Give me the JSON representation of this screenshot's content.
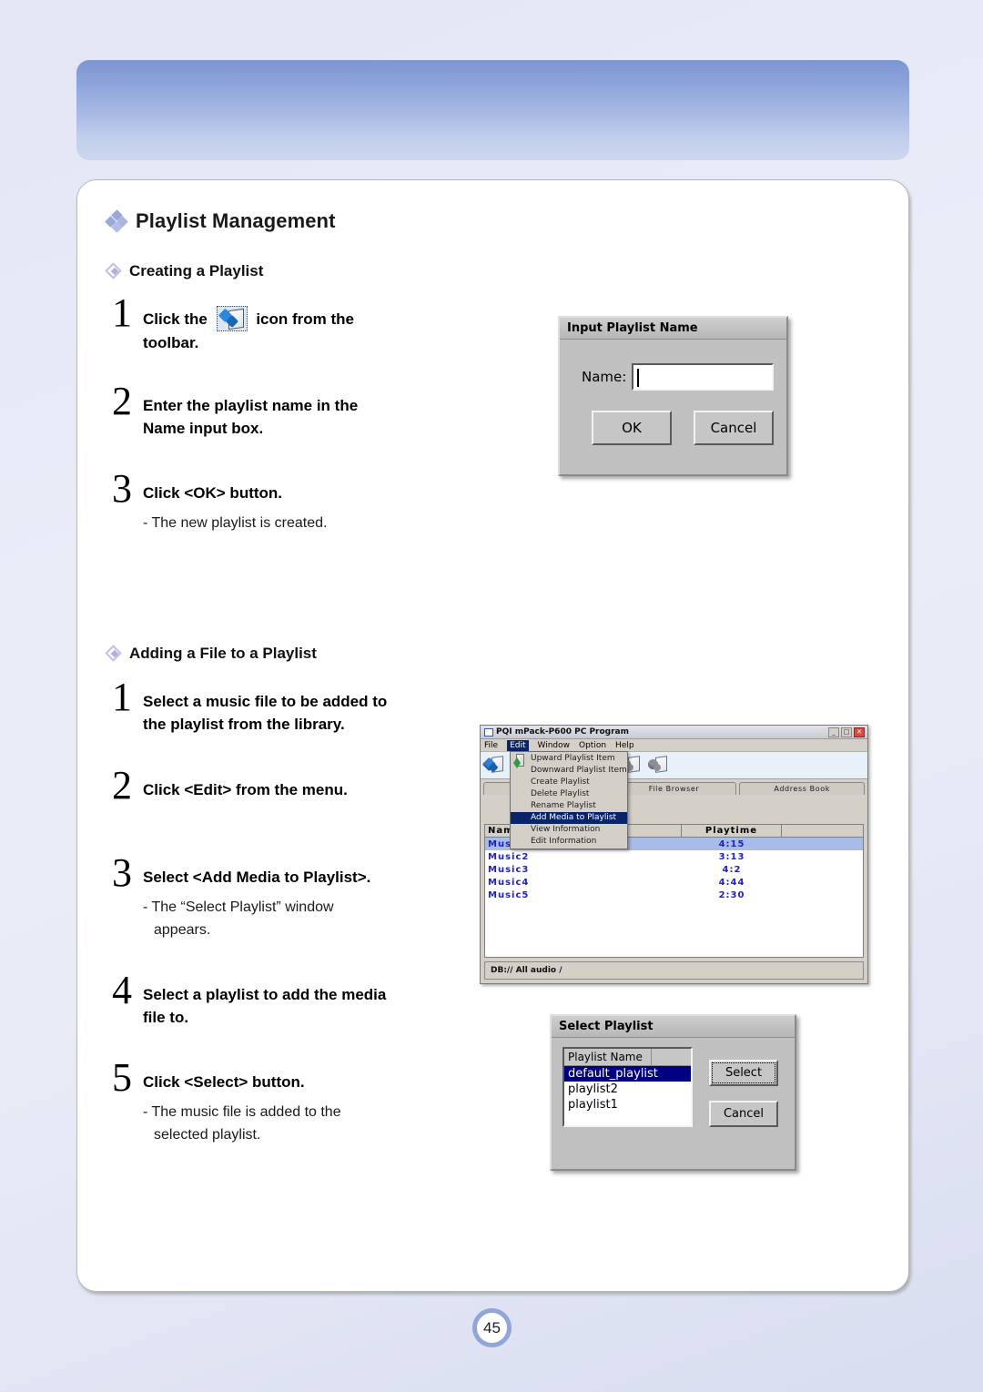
{
  "page": {
    "number": "45",
    "accent_blue": "#8fa6d8",
    "banner_color": "#8ca2d9"
  },
  "section": {
    "title": "Playlist Management"
  },
  "creating": {
    "heading": "Creating a Playlist",
    "steps": [
      {
        "num": "1",
        "pre": "Click the",
        "post": "icon from the",
        "line2": "toolbar.",
        "icon": "playlist-toolbar-icon"
      },
      {
        "num": "2",
        "line1": "Enter the playlist name in the",
        "line2": "Name input box."
      },
      {
        "num": "3",
        "line1": "Click <OK> button.",
        "note1": "- The new playlist is created."
      }
    ]
  },
  "adding": {
    "heading": "Adding a File to a Playlist",
    "steps": [
      {
        "num": "1",
        "line1": "Select a music file to be added to",
        "line2": "the playlist from the library."
      },
      {
        "num": "2",
        "line1": "Click <Edit> from the menu."
      },
      {
        "num": "3",
        "line1": "Select <Add Media to Playlist>.",
        "note1": "- The “Select Playlist” window",
        "note2": "appears."
      },
      {
        "num": "4",
        "line1": "Select a playlist to add the media",
        "line2": "file to."
      },
      {
        "num": "5",
        "line1": "Click <Select> button.",
        "note1": "- The music file is added to the",
        "note2": "selected playlist."
      }
    ]
  },
  "input_dialog": {
    "title": "Input Playlist Name",
    "name_label": "Name:",
    "name_value": "",
    "ok_label": "OK",
    "cancel_label": "Cancel"
  },
  "select_dialog": {
    "title": "Select Playlist",
    "column_header": "Playlist Name",
    "items": [
      "default_playlist",
      "playlist2",
      "playlist1"
    ],
    "selected_index": 0,
    "select_label": "Select",
    "cancel_label": "Cancel"
  },
  "pc_program": {
    "title": "PQI mPack-P600 PC Program",
    "window_buttons": {
      "minimize": "_",
      "maximize": "□",
      "close": "✕"
    },
    "menus": [
      "File",
      "Edit",
      "Window",
      "Option",
      "Help"
    ],
    "active_menu": "Edit",
    "dropdown_items": [
      "Upward Playlist Item",
      "Downward Playlist Item",
      "Create Playlist",
      "Delete Playlist",
      "Rename Playlist",
      "Add Media to Playlist",
      "View Information",
      "Edit Information"
    ],
    "dropdown_highlighted": "Add Media to Playlist",
    "tabs": [
      "",
      "File Browser",
      "Address Book"
    ],
    "grid_headers": {
      "name": "Name",
      "blank": "",
      "playtime": "Playtime",
      "extra": ""
    },
    "rows": [
      {
        "name": "Music1",
        "playtime": "4:15",
        "selected": true
      },
      {
        "name": "Music2",
        "playtime": "3:13",
        "selected": false
      },
      {
        "name": "Music3",
        "playtime": "4:2",
        "selected": false
      },
      {
        "name": "Music4",
        "playtime": "4:44",
        "selected": false
      },
      {
        "name": "Music5",
        "playtime": "2:30",
        "selected": false
      }
    ],
    "status": "DB:// All audio /"
  }
}
